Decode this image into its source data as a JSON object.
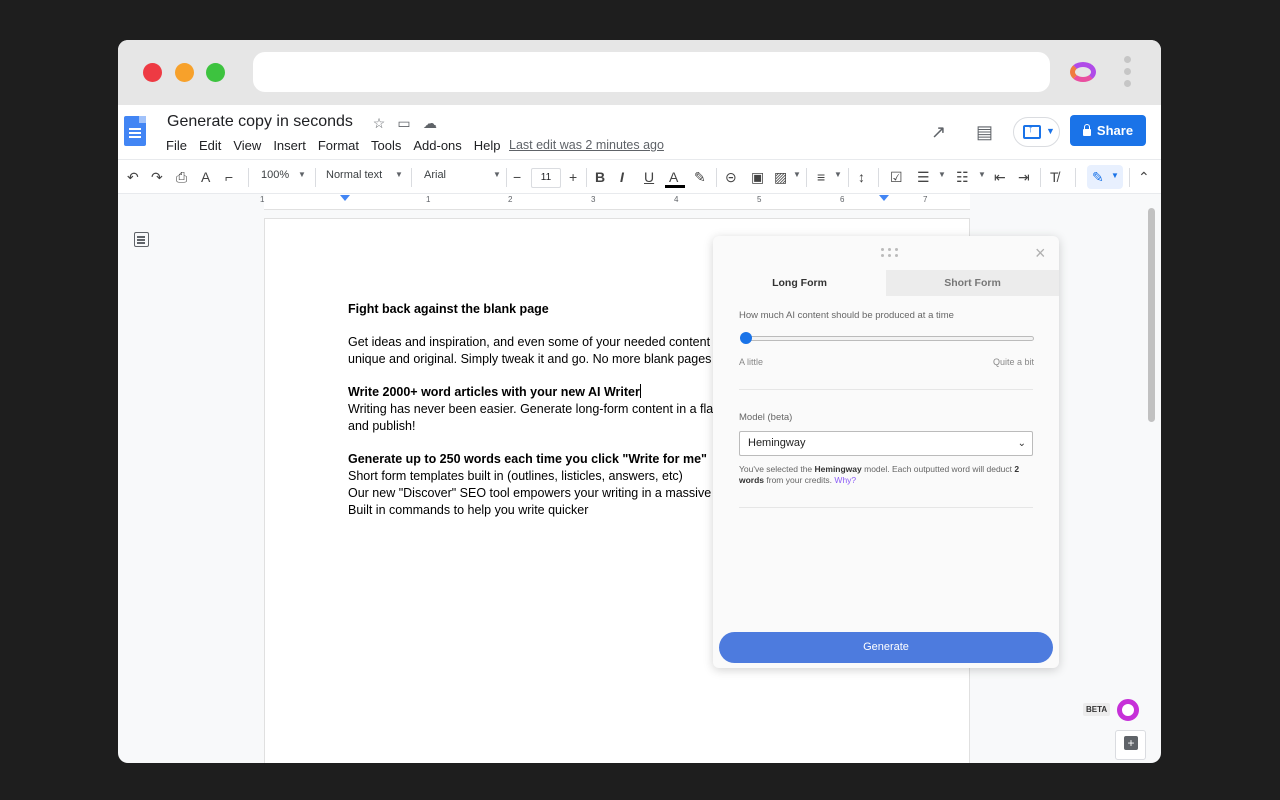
{
  "document": {
    "title": "Generate copy in seconds",
    "last_edit": "Last edit was 2 minutes ago",
    "menu": [
      "File",
      "Edit",
      "View",
      "Insert",
      "Format",
      "Tools",
      "Add-ons",
      "Help"
    ],
    "share_label": "Share"
  },
  "toolbar": {
    "zoom": "100%",
    "style": "Normal text",
    "font": "Arial",
    "font_size": "11"
  },
  "ruler": {
    "ticks": [
      "1",
      "1",
      "2",
      "3",
      "4",
      "5",
      "6",
      "7"
    ]
  },
  "content": {
    "h1": "Fight back against the blank page",
    "p1_line1": "Get ideas and inspiration, and even some of your needed content",
    "p1_line2": "unique and original. Simply tweak it and go. No more blank pages",
    "h2": "Write 2000+ word articles with your new AI Writer",
    "p2_line1": "Writing has never been easier. Generate long-form content in a fla",
    "p2_line2": "and publish!",
    "h3": "Generate up to 250 words each time you click \"Write for me\"",
    "p3_line1": "Short form templates built in (outlines, listicles, answers, etc)",
    "p3_line2": "Our new \"Discover\" SEO tool empowers your writing in a massive",
    "p3_line3": "Built in commands to help you write quicker"
  },
  "panel": {
    "tabs": [
      "Long Form",
      "Short Form"
    ],
    "active_tab": "Long Form",
    "slider_label": "How much AI content should be produced at a time",
    "slider_min_label": "A little",
    "slider_max_label": "Quite a bit",
    "slider_value": 0,
    "model_label": "Model (beta)",
    "model_selected": "Hemingway",
    "note_pre": "You've selected the ",
    "note_model": "Hemingway",
    "note_mid": " model. Each outputted word will deduct ",
    "note_words": "2 words",
    "note_post": " from your credits. ",
    "note_why": "Why?",
    "generate_label": "Generate"
  },
  "badges": {
    "beta": "BETA"
  },
  "colors": {
    "share_button": "#1a73e8",
    "generate_button": "#4d7bde",
    "accent_purple": "#c630d8"
  }
}
